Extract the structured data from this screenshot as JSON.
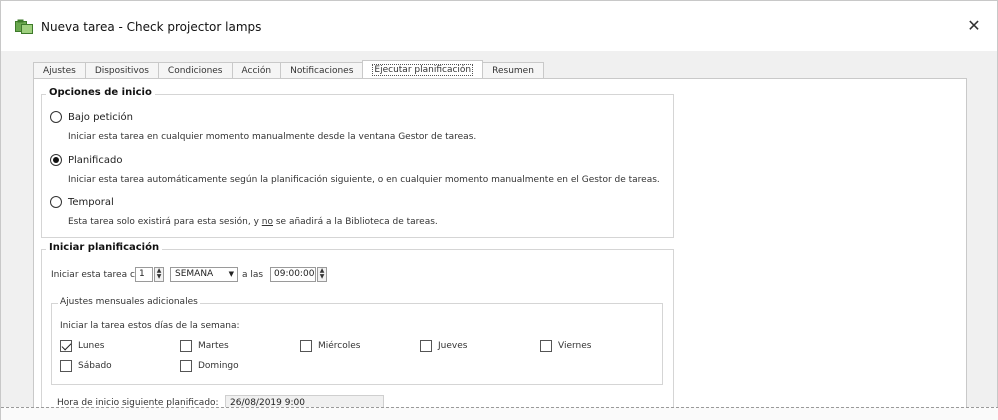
{
  "window": {
    "title": "Nueva tarea - Check projector lamps",
    "close_glyph": "✕"
  },
  "tabs": [
    {
      "label": "Ajustes"
    },
    {
      "label": "Dispositivos"
    },
    {
      "label": "Condiciones"
    },
    {
      "label": "Acción"
    },
    {
      "label": "Notificaciones"
    },
    {
      "label": "Ejecutar planificación"
    },
    {
      "label": "Resumen"
    }
  ],
  "start_options": {
    "title": "Opciones de inicio",
    "on_demand": {
      "label": "Bajo petición",
      "desc": "Iniciar esta tarea en cualquier momento manualmente desde la ventana Gestor de tareas."
    },
    "scheduled": {
      "label": "Planificado",
      "desc": "Iniciar esta tarea automáticamente según la planificación siguiente, o en cualquier momento manualmente en el Gestor de tareas."
    },
    "temporary": {
      "label": "Temporal",
      "desc_pre": "Esta tarea solo existirá para esta sesión, y ",
      "desc_u": "no",
      "desc_post": " se añadirá a la Biblioteca de tareas."
    },
    "selected": "scheduled"
  },
  "schedule": {
    "title": "Iniciar planificación",
    "every_label": "Iniciar esta tarea cada",
    "every_value": "1",
    "period_value": "SEMANA",
    "at_label": "a las",
    "time_value": "09:00:00",
    "monthly": {
      "title": "Ajustes mensuales adicionales",
      "days_label": "Iniciar la tarea estos días de la semana:",
      "days": [
        {
          "label": "Lunes",
          "checked": true
        },
        {
          "label": "Martes",
          "checked": false
        },
        {
          "label": "Miércoles",
          "checked": false
        },
        {
          "label": "Jueves",
          "checked": false
        },
        {
          "label": "Viernes",
          "checked": false
        },
        {
          "label": "Sábado",
          "checked": false
        },
        {
          "label": "Domingo",
          "checked": false
        }
      ]
    },
    "next_start_label": "Hora de inicio siguiente planificado:",
    "next_start_value": "26/08/2019 9:00"
  },
  "icons": {
    "app": "task-app-icon",
    "close": "close-icon",
    "dropdown": "chevron-down-icon",
    "spinner": "spinner-arrows-icon"
  }
}
